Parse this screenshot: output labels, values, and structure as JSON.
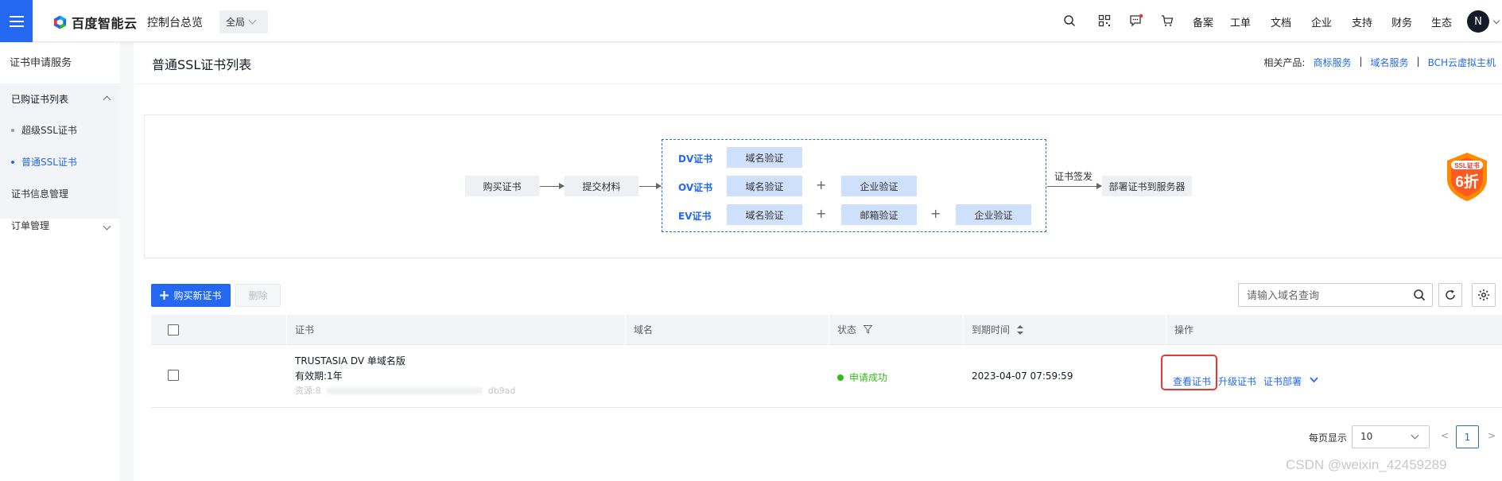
{
  "topbar": {
    "brand": "百度智能云",
    "console_link": "控制台总览",
    "region": "全局",
    "nav": [
      "备案",
      "工单",
      "文档",
      "企业",
      "支持",
      "财务",
      "生态"
    ],
    "avatar_initial": "N",
    "colors": {
      "accent": "#2468f2",
      "notify_dot": "#e53935"
    }
  },
  "sidebar": {
    "title": "证书申请服务",
    "group_label": "已购证书列表",
    "sub_items": [
      "超级SSL证书",
      "普通SSL证书"
    ],
    "active_item": "普通SSL证书",
    "items": [
      "证书信息管理",
      "订单管理"
    ]
  },
  "page": {
    "title": "普通SSL证书列表",
    "related_label": "相关产品:",
    "related_links": [
      "商标服务",
      "域名服务",
      "BCH云虚拟主机"
    ]
  },
  "flow": {
    "steps": [
      "购买证书",
      "提交材料"
    ],
    "types": [
      "DV证书",
      "OV证书",
      "EV证书"
    ],
    "dv_checks": [
      "域名验证"
    ],
    "ov_checks": [
      "域名验证",
      "企业验证"
    ],
    "ev_checks": [
      "域名验证",
      "邮箱验证",
      "企业验证"
    ],
    "plus_symbol": "+",
    "issue_label": "证书签发",
    "final_step": "部署证书到服务器",
    "promo_top": "SSL证书",
    "promo_main": "6折"
  },
  "toolbar": {
    "buy_label": "购买新证书",
    "delete_label": "删除",
    "search_placeholder": "请输入域名查询"
  },
  "table": {
    "headers": [
      "证书",
      "域名",
      "状态",
      "到期时间",
      "操作"
    ],
    "rows": [
      {
        "cert_name": "TRUSTASIA DV 单域名版",
        "validity": "有效期:1年",
        "resource_prefix": "资源:8",
        "resource_tail": "db9ad",
        "domain": "",
        "status": "申请成功",
        "expire": "2023-04-07 07:59:59",
        "ops": [
          "查看证书",
          "升级证书",
          "证书部署"
        ]
      }
    ]
  },
  "pagination": {
    "page_size_label": "每页显示",
    "page_size": "10",
    "prev": "<",
    "current_page": "1",
    "next": ">"
  },
  "watermark": "CSDN @weixin_42459289"
}
